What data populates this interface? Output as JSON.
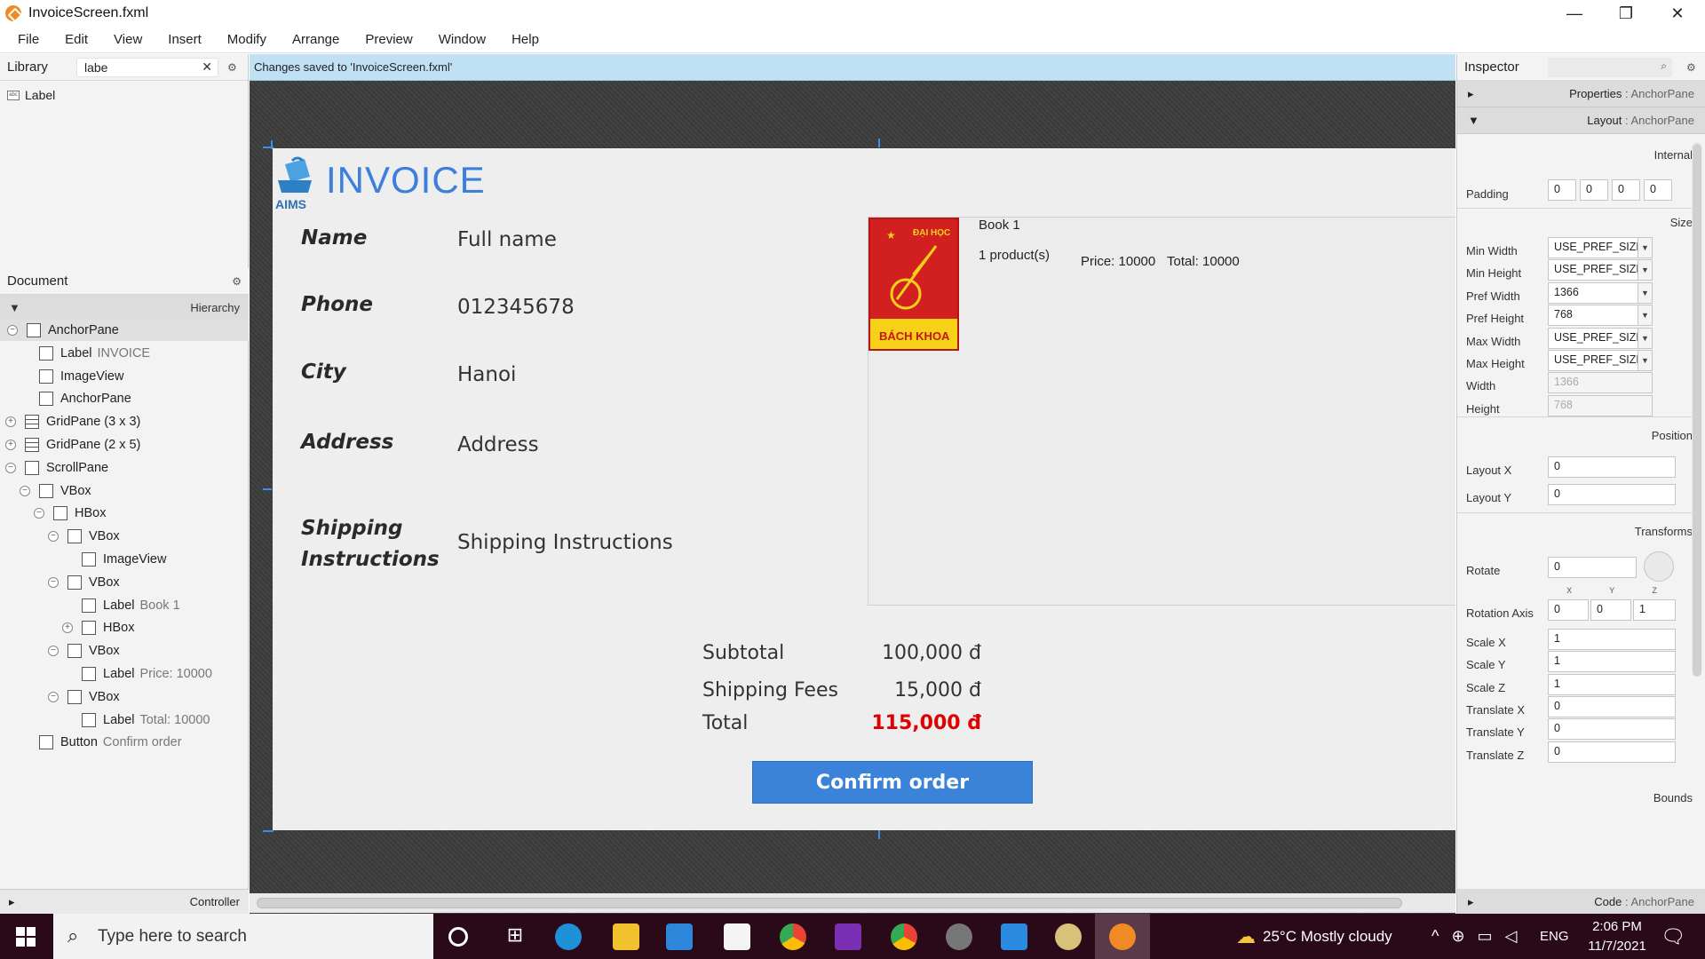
{
  "window": {
    "title": "InvoiceScreen.fxml",
    "minimize": "—",
    "restore": "❐",
    "close": "✕"
  },
  "menu": [
    "File",
    "Edit",
    "View",
    "Insert",
    "Modify",
    "Arrange",
    "Preview",
    "Window",
    "Help"
  ],
  "library": {
    "title": "Library",
    "search_value": "labe",
    "clear": "✕",
    "items": [
      {
        "label": "Label",
        "icon": "label-icon"
      }
    ]
  },
  "status_message": "Changes saved to 'InvoiceScreen.fxml'",
  "document": {
    "title": "Document",
    "hierarchy_label": "Hierarchy",
    "tree": [
      {
        "type": "AnchorPane",
        "detail": "",
        "toggle": "−",
        "icon": "anchorpane-icon"
      },
      {
        "type": "Label",
        "detail": "INVOICE",
        "toggle": "",
        "icon": "label-icon"
      },
      {
        "type": "ImageView",
        "detail": "",
        "toggle": "",
        "icon": "imageview-icon"
      },
      {
        "type": "AnchorPane",
        "detail": "",
        "toggle": "",
        "icon": "anchorpane-icon"
      },
      {
        "type": "GridPane (3 x 3)",
        "detail": "",
        "toggle": "+",
        "icon": "gridpane-icon"
      },
      {
        "type": "GridPane (2 x 5)",
        "detail": "",
        "toggle": "+",
        "icon": "gridpane-icon"
      },
      {
        "type": "ScrollPane",
        "detail": "",
        "toggle": "−",
        "icon": "scrollpane-icon"
      },
      {
        "type": "VBox",
        "detail": "",
        "toggle": "−",
        "icon": "vbox-icon"
      },
      {
        "type": "HBox",
        "detail": "",
        "toggle": "−",
        "icon": "hbox-icon"
      },
      {
        "type": "VBox",
        "detail": "",
        "toggle": "−",
        "icon": "vbox-icon"
      },
      {
        "type": "ImageView",
        "detail": "",
        "toggle": "",
        "icon": "imageview-icon"
      },
      {
        "type": "VBox",
        "detail": "",
        "toggle": "−",
        "icon": "vbox-icon"
      },
      {
        "type": "Label",
        "detail": "Book 1",
        "toggle": "",
        "icon": "label-icon"
      },
      {
        "type": "HBox",
        "detail": "",
        "toggle": "+",
        "icon": "hbox-icon"
      },
      {
        "type": "VBox",
        "detail": "",
        "toggle": "−",
        "icon": "vbox-icon"
      },
      {
        "type": "Label",
        "detail": "Price: 10000",
        "toggle": "",
        "icon": "label-icon"
      },
      {
        "type": "VBox",
        "detail": "",
        "toggle": "−",
        "icon": "vbox-icon"
      },
      {
        "type": "Label",
        "detail": "Total: 10000",
        "toggle": "",
        "icon": "label-icon"
      },
      {
        "type": "Button",
        "detail": "Confirm order",
        "toggle": "",
        "icon": "button-icon"
      }
    ],
    "controller_label": "Controller"
  },
  "invoice": {
    "logo_text": "AIMS",
    "title": "INVOICE",
    "fields": [
      {
        "label": "Name",
        "value": "Full name"
      },
      {
        "label": "Phone",
        "value": "012345678"
      },
      {
        "label": "City",
        "value": "Hanoi"
      },
      {
        "label": "Address",
        "value": "Address"
      },
      {
        "label": "Shipping Instructions",
        "value": "Shipping Instructions"
      }
    ],
    "product": {
      "book_logo_top": "ĐẠI HỌC",
      "book_logo_bottom": "BÁCH KHOA",
      "name": "Book 1",
      "quantity": "1 product(s)",
      "price": "Price: 10000",
      "total": "Total: 10000"
    },
    "summary": {
      "subtotal_label": "Subtotal",
      "subtotal_value": "100,000 đ",
      "shipping_label": "Shipping Fees",
      "shipping_value": "15,000 đ",
      "total_label": "Total",
      "total_value": "115,000 đ"
    },
    "confirm_button": "Confirm order"
  },
  "inspector": {
    "title": "Inspector",
    "properties_section": "Properties",
    "properties_target": " : AnchorPane",
    "layout_section": "Layout",
    "layout_target": " : AnchorPane",
    "internal_label": "Internal",
    "padding_label": "Padding",
    "padding_values": [
      "0",
      "0",
      "0",
      "0"
    ],
    "size_label": "Size",
    "size_rows": [
      {
        "label": "Min Width",
        "value": "USE_PREF_SIZE",
        "dropdown": true,
        "disabled": false
      },
      {
        "label": "Min Height",
        "value": "USE_PREF_SIZE",
        "dropdown": true,
        "disabled": false
      },
      {
        "label": "Pref Width",
        "value": "1366",
        "dropdown": true,
        "disabled": false
      },
      {
        "label": "Pref Height",
        "value": "768",
        "dropdown": true,
        "disabled": false
      },
      {
        "label": "Max Width",
        "value": "USE_PREF_SIZE",
        "dropdown": true,
        "disabled": false
      },
      {
        "label": "Max Height",
        "value": "USE_PREF_SIZE",
        "dropdown": true,
        "disabled": false
      },
      {
        "label": "Width",
        "value": "1366",
        "dropdown": false,
        "disabled": true
      },
      {
        "label": "Height",
        "value": "768",
        "dropdown": false,
        "disabled": true
      }
    ],
    "position_label": "Position",
    "layout_x_label": "Layout X",
    "layout_x": "0",
    "layout_y_label": "Layout Y",
    "layout_y": "0",
    "transforms_label": "Transforms",
    "rotate_label": "Rotate",
    "rotate": "0",
    "axis_headers": [
      "X",
      "Y",
      "Z"
    ],
    "rotation_axis_label": "Rotation Axis",
    "rotation_axis": [
      "0",
      "0",
      "1"
    ],
    "transform_rows": [
      {
        "label": "Scale X",
        "value": "1"
      },
      {
        "label": "Scale Y",
        "value": "1"
      },
      {
        "label": "Scale Z",
        "value": "1"
      },
      {
        "label": "Translate X",
        "value": "0"
      },
      {
        "label": "Translate Y",
        "value": "0"
      },
      {
        "label": "Translate Z",
        "value": "0"
      }
    ],
    "bounds_label": "Bounds",
    "code_section": "Code",
    "code_target": " : AnchorPane"
  },
  "taskbar": {
    "search_placeholder": "Type here to search",
    "weather": "25°C  Mostly cloudy",
    "language": "ENG",
    "time": "2:06 PM",
    "date": "11/7/2021"
  },
  "colors": {
    "accent": "#3b82d9",
    "invoice_title": "#3c7fdc",
    "total_red": "#e00000",
    "status_bg": "#bfe1f3",
    "taskbar": "#2a0a18"
  }
}
